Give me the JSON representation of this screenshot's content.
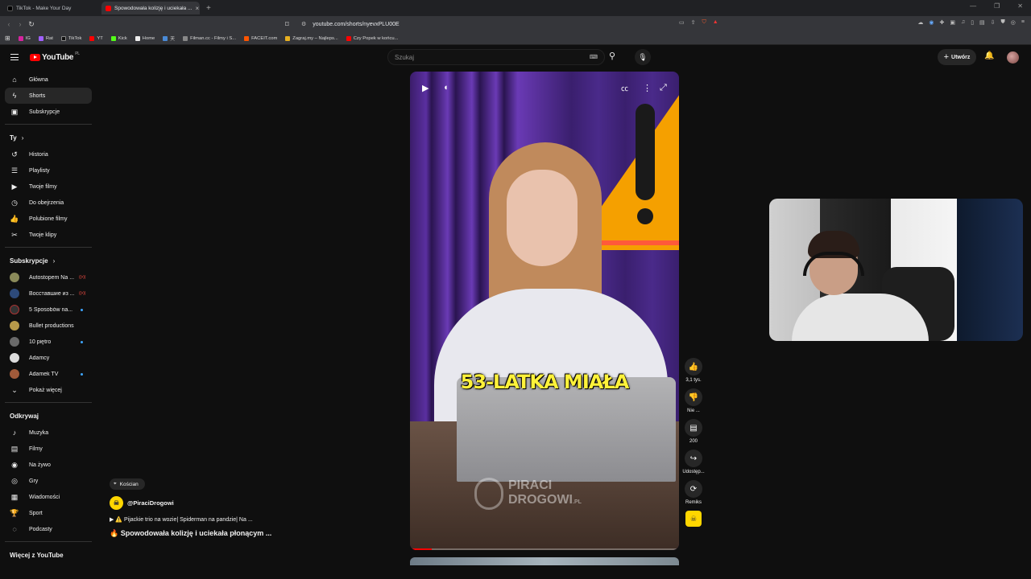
{
  "browser": {
    "tabs": [
      {
        "title": "TikTok - Make Your Day",
        "active": false
      },
      {
        "title": "Spowodowała kolizję i uciekała ...",
        "active": true
      }
    ],
    "url": "youtube.com/shorts/nyevxPLU00E",
    "bookmarks": [
      "IG",
      "Rat",
      "TikTok",
      "YT",
      "Kick",
      "Home",
      "天",
      "Filman.cc - Filmy i S...",
      "FACEIT.com",
      "Zagraj.my – Najleps...",
      "Czy Popek w końcu..."
    ]
  },
  "header": {
    "logo_text": "YouTube",
    "logo_region": "PL",
    "search_placeholder": "Szukaj",
    "create_label": "Utwórz"
  },
  "sidebar": {
    "main": [
      {
        "label": "Główna",
        "icon": "home-icon"
      },
      {
        "label": "Shorts",
        "icon": "shorts-icon",
        "active": true
      },
      {
        "label": "Subskrypcje",
        "icon": "subscriptions-icon"
      }
    ],
    "you_heading": "Ty",
    "you": [
      {
        "label": "Historia",
        "icon": "history-icon"
      },
      {
        "label": "Playlisty",
        "icon": "playlist-icon"
      },
      {
        "label": "Twoje filmy",
        "icon": "your-videos-icon"
      },
      {
        "label": "Do obejrzenia",
        "icon": "watch-later-icon"
      },
      {
        "label": "Polubione filmy",
        "icon": "liked-icon"
      },
      {
        "label": "Twoje klipy",
        "icon": "scissors-icon"
      }
    ],
    "subs_heading": "Subskrypcje",
    "subs": [
      {
        "label": "Autostopem Na ...",
        "badge": "live",
        "color": "#8a8a5a"
      },
      {
        "label": "Восставшие из ...",
        "badge": "live",
        "color": "#2d4a7a"
      },
      {
        "label": "5 Sposobów na...",
        "badge": "dot",
        "color": "#333"
      },
      {
        "label": "Bullet productions",
        "badge": "",
        "color": "#b89a4a"
      },
      {
        "label": "10 piętro",
        "badge": "dot",
        "color": "#6a6a6a"
      },
      {
        "label": "Adamcy",
        "badge": "",
        "color": "#ddd"
      },
      {
        "label": "Adamek TV",
        "badge": "dot",
        "color": "#a05a3a"
      }
    ],
    "show_more": "Pokaż więcej",
    "explore_heading": "Odkrywaj",
    "explore": [
      {
        "label": "Muzyka",
        "icon": "music-icon"
      },
      {
        "label": "Filmy",
        "icon": "movies-icon"
      },
      {
        "label": "Na żywo",
        "icon": "live-icon"
      },
      {
        "label": "Gry",
        "icon": "gaming-icon"
      },
      {
        "label": "Wiadomości",
        "icon": "news-icon"
      },
      {
        "label": "Sport",
        "icon": "trophy-icon"
      },
      {
        "label": "Podcasty",
        "icon": "podcast-icon"
      }
    ],
    "more_heading": "Więcej z YouTube"
  },
  "video": {
    "caption": "53-LATKA MIAŁA",
    "watermark_line1": "PIRACI",
    "watermark_line2": "DROGOWI",
    "watermark_suffix": ".PL",
    "progress": 0.08
  },
  "actions": {
    "likes": "3,1 tys.",
    "dislike": "Nie ...",
    "comments": "200",
    "share": "Udostęp...",
    "remix": "Remiks"
  },
  "meta": {
    "location": "Kościan",
    "channel": "@PiraciDrogowi",
    "playlist": "⚠️ Pijackie trio na wozie| Spiderman na pandzie| Na ...",
    "title": "🔥 Spowodowała kolizję i uciekała płonącym ..."
  }
}
